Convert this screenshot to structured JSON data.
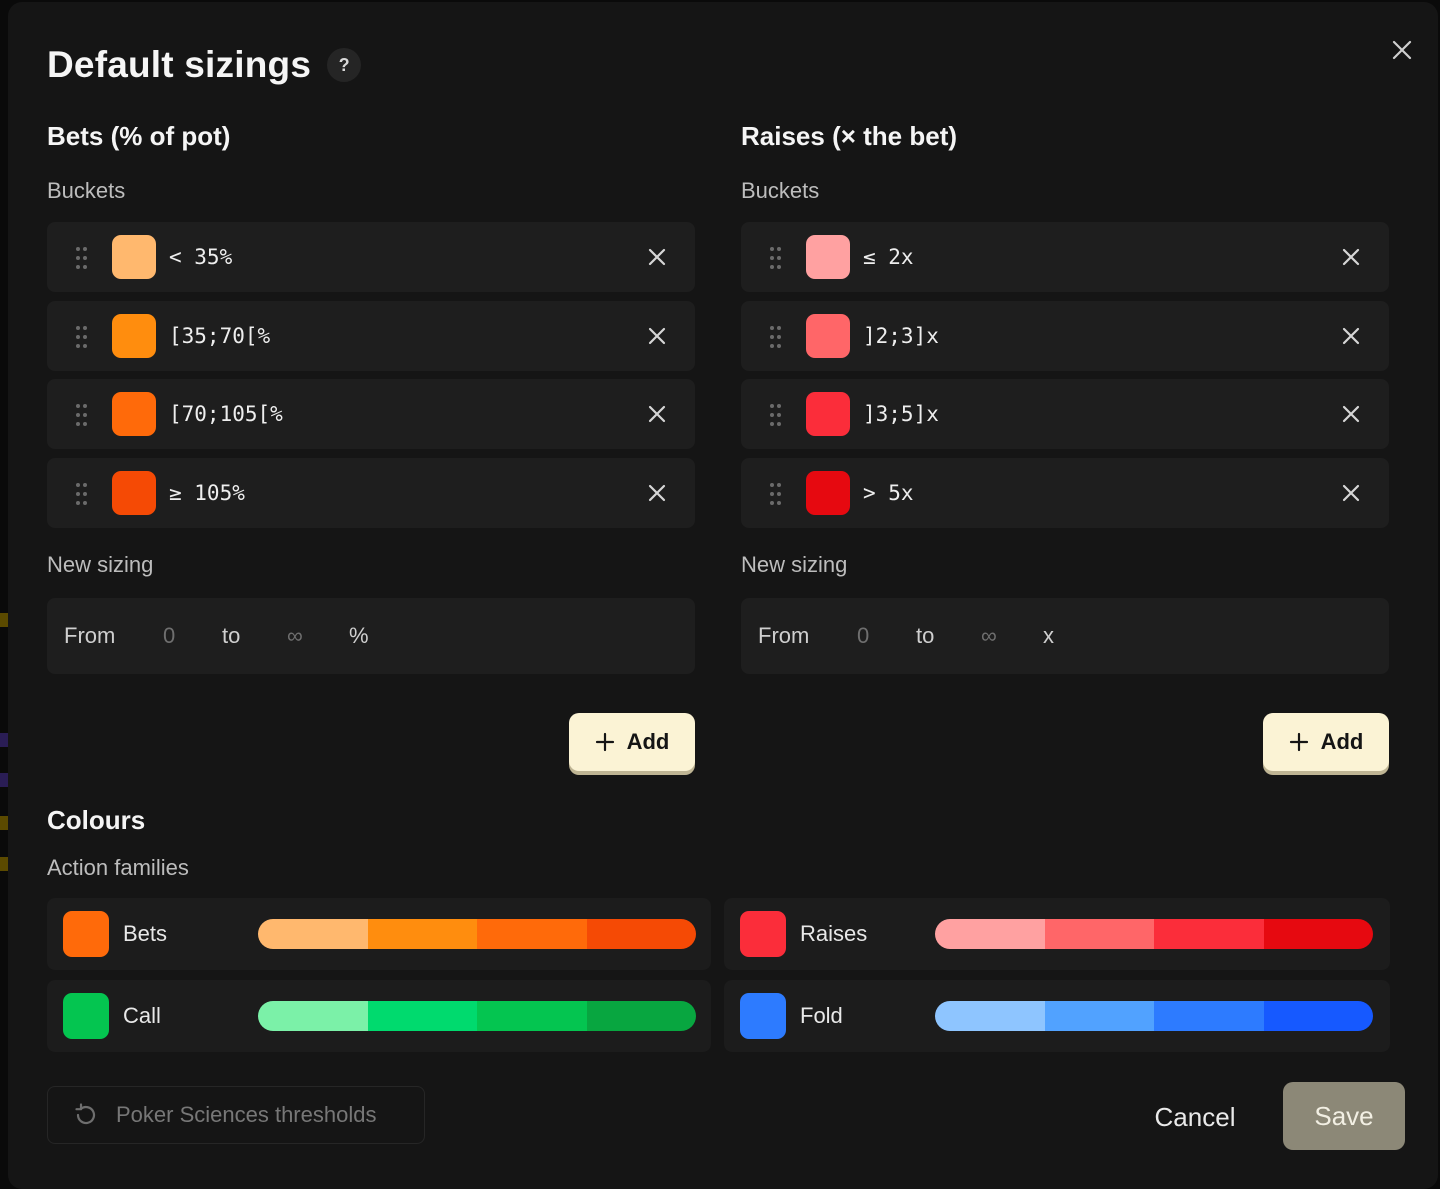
{
  "dialog": {
    "title": "Default sizings",
    "help_label": "?",
    "close_icon": "close-icon"
  },
  "bets": {
    "title": "Bets (% of pot)",
    "buckets_label": "Buckets",
    "buckets": [
      {
        "label": "< 35%",
        "color": "#FFB86E"
      },
      {
        "label": "[35;70[%",
        "color": "#FF8D0E"
      },
      {
        "label": "[70;105[%",
        "color": "#FF6A0A"
      },
      {
        "label": "≥ 105%",
        "color": "#F54A05"
      }
    ],
    "new_sizing_label": "New sizing",
    "new_sizing": {
      "from_label": "From",
      "from_placeholder": "0",
      "to_label": "to",
      "to_placeholder": "∞",
      "unit": "%"
    },
    "add_label": "Add"
  },
  "raises": {
    "title": "Raises (× the bet)",
    "buckets_label": "Buckets",
    "buckets": [
      {
        "label": "≤ 2x",
        "color": "#FFA1A1"
      },
      {
        "label": "]2;3]x",
        "color": "#FF6668"
      },
      {
        "label": "]3;5]x",
        "color": "#FB2D3A"
      },
      {
        "label": "> 5x",
        "color": "#E60910"
      }
    ],
    "new_sizing_label": "New sizing",
    "new_sizing": {
      "from_label": "From",
      "from_placeholder": "0",
      "to_label": "to",
      "to_placeholder": "∞",
      "unit": "x"
    },
    "add_label": "Add"
  },
  "colours": {
    "title": "Colours",
    "families_label": "Action families",
    "families": [
      {
        "label": "Bets",
        "color": "#FF6A0A",
        "gradient": [
          "#FFB86E",
          "#FF8D0E",
          "#FF6A0A",
          "#F54A05"
        ]
      },
      {
        "label": "Raises",
        "color": "#FB2D3A",
        "gradient": [
          "#FFA1A1",
          "#FF6668",
          "#FB2D3A",
          "#E60910"
        ]
      },
      {
        "label": "Call",
        "color": "#04C550",
        "gradient": [
          "#7BF1A8",
          "#00DA6E",
          "#04C550",
          "#08A640"
        ]
      },
      {
        "label": "Fold",
        "color": "#2D7BFF",
        "gradient": [
          "#8EC5FF",
          "#51A2FF",
          "#2D7BFF",
          "#1659FF"
        ]
      }
    ]
  },
  "footer": {
    "reset_label": "Poker Sciences thresholds",
    "cancel_label": "Cancel",
    "save_label": "Save"
  }
}
